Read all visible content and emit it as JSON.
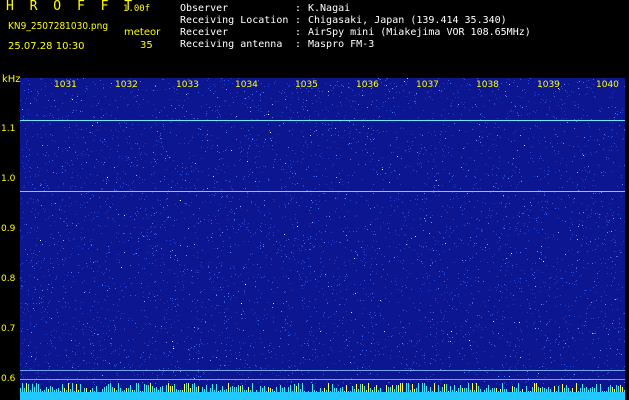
{
  "app": {
    "logo": "H R O F F T",
    "version": "1.00f"
  },
  "file": {
    "name": "KN9_2507281030.png",
    "datetime": "25.07.28 10:30"
  },
  "meteor": {
    "label": "meteor",
    "count": "35"
  },
  "info": [
    {
      "key": "Observer",
      "value": "K.Nagai"
    },
    {
      "key": "Receiving Location",
      "value": "Chigasaki, Japan (139.414 35.340)"
    },
    {
      "key": "Receiver",
      "value": "AirSpy mini (Miakejima VOR 108.65MHz)"
    },
    {
      "key": "Receiving antenna",
      "value": "Maspro FM-3"
    }
  ],
  "axis": {
    "unit": "kHz",
    "x_ticks": [
      "1031",
      "1032",
      "1033",
      "1034",
      "1035",
      "1036",
      "1037",
      "1038",
      "1039",
      "1040"
    ],
    "y_ticks": [
      "1.1",
      "1.0",
      "0.9",
      "0.8",
      "0.7",
      "0.6"
    ]
  },
  "colors": {
    "text": "#ffff00",
    "background": "#0c1690",
    "lines": "#40e0ff"
  }
}
